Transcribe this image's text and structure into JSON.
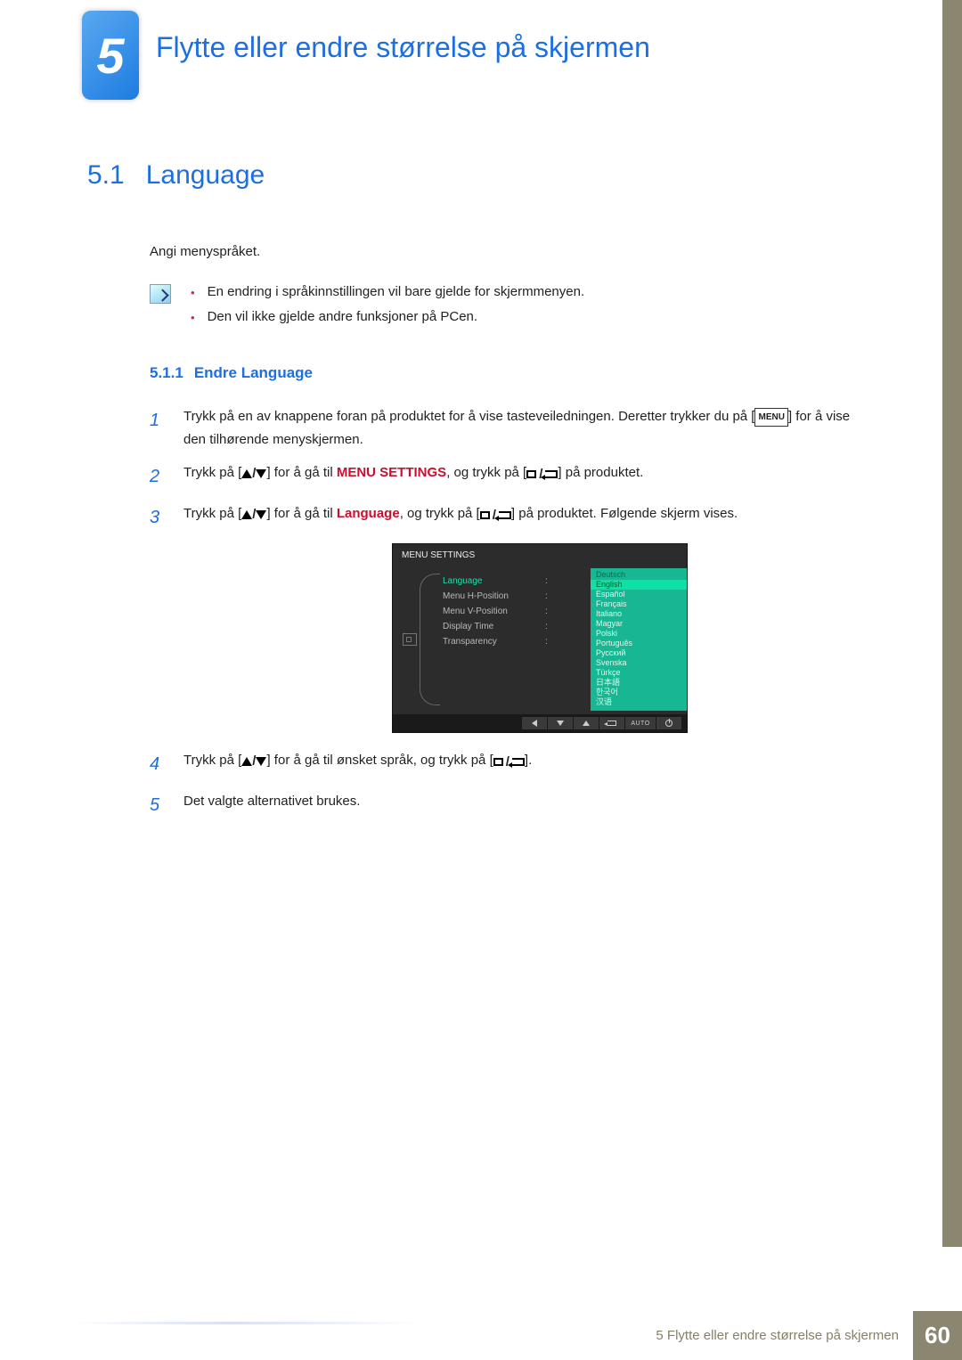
{
  "chapter": {
    "number": "5",
    "title": "Flytte eller endre størrelse på skjermen"
  },
  "section": {
    "number": "5.1",
    "title": "Language",
    "intro": "Angi menyspråket."
  },
  "notes": [
    "En endring i språkinnstillingen vil bare gjelde for skjermmenyen.",
    "Den vil ikke gjelde andre funksjoner på PCen."
  ],
  "subsection": {
    "number": "5.1.1",
    "title": "Endre Language"
  },
  "steps": {
    "s1a": "Trykk på en av knappene foran på produktet for å vise tasteveiledningen. Deretter trykker du på [",
    "s1b": "] for å vise den tilhørende menyskjermen.",
    "s2a": "Trykk på [",
    "s2b": "] for å gå til ",
    "s2c": "MENU SETTINGS",
    "s2d": ", og trykk på [",
    "s2e": "] på produktet.",
    "s3a": "Trykk på [",
    "s3b": "] for å gå til ",
    "s3c": "Language",
    "s3d": ", og trykk på [",
    "s3e": "] på produktet. Følgende skjerm vises.",
    "s4a": "Trykk på [",
    "s4b": "] for å gå til ønsket språk, og trykk på [",
    "s4c": "].",
    "s5": "Det valgte alternativet brukes."
  },
  "menuBtn": "MENU",
  "osd": {
    "title": "MENU SETTINGS",
    "items": [
      "Language",
      "Menu H-Position",
      "Menu V-Position",
      "Display Time",
      "Transparency"
    ],
    "languages": [
      "Deutsch",
      "English",
      "Español",
      "Français",
      "Italiano",
      "Magyar",
      "Polski",
      "Português",
      "Русский",
      "Svenska",
      "Türkçe",
      "日本語",
      "한국어",
      "汉语"
    ],
    "selected_language_index": 1,
    "auto_label": "AUTO"
  },
  "footer": {
    "text": "5 Flytte eller endre størrelse på skjermen",
    "page": "60"
  }
}
